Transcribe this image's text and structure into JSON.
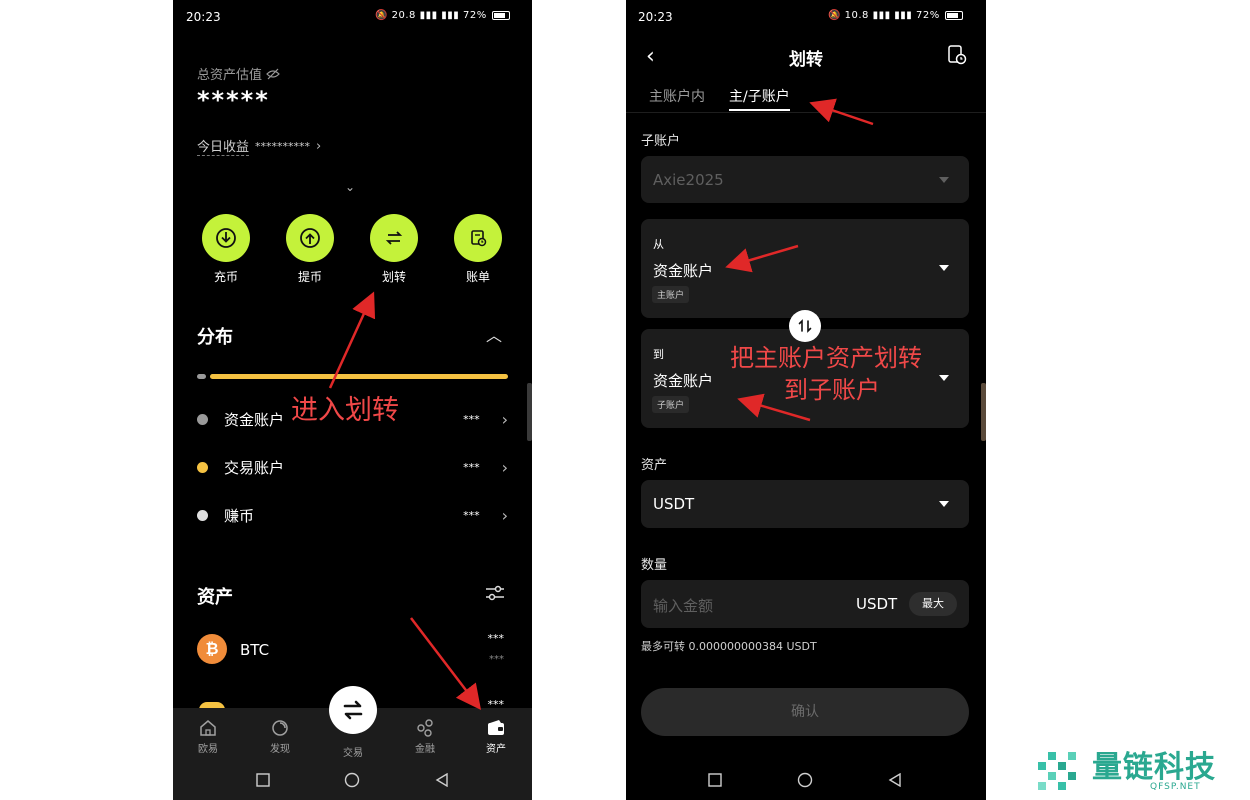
{
  "left": {
    "status": {
      "time": "20:23",
      "battery": "72%",
      "speed": "20.8"
    },
    "total_assets_label": "总资产估值",
    "total_assets_value": "*****",
    "today_pnl_label": "今日收益",
    "today_pnl_value": "**********",
    "actions": [
      {
        "label": "充币",
        "icon": "deposit-icon"
      },
      {
        "label": "提币",
        "icon": "withdraw-icon"
      },
      {
        "label": "划转",
        "icon": "transfer-icon"
      },
      {
        "label": "账单",
        "icon": "bill-icon"
      }
    ],
    "distribution_title": "分布",
    "distribution_rows": [
      {
        "label": "资金账户",
        "value": "***",
        "color": "#9a9a9a"
      },
      {
        "label": "交易账户",
        "value": "***",
        "color": "#f5c242"
      },
      {
        "label": "赚币",
        "value": "***",
        "color": "#e0e0e0"
      }
    ],
    "assets_title": "资产",
    "assets": [
      {
        "symbol": "BTC",
        "value": "***",
        "sub": "***"
      },
      {
        "symbol": "",
        "value": "***",
        "sub": ""
      }
    ],
    "nav": [
      {
        "label": "欧易",
        "icon": "home-icon"
      },
      {
        "label": "发现",
        "icon": "discover-icon"
      },
      {
        "label": "交易",
        "icon": "trade-icon"
      },
      {
        "label": "金融",
        "icon": "finance-icon"
      },
      {
        "label": "资产",
        "icon": "wallet-icon"
      }
    ],
    "annotation": "进入划转"
  },
  "right": {
    "status": {
      "time": "20:23",
      "battery": "72%",
      "speed": "10.8"
    },
    "title": "划转",
    "tabs": [
      "主账户内",
      "主/子账户"
    ],
    "active_tab": 1,
    "sub_account_label": "子账户",
    "sub_account_value": "Axie2025",
    "from_label": "从",
    "from_value": "资金账户",
    "from_tag": "主账户",
    "to_label": "到",
    "to_value": "资金账户",
    "to_tag": "子账户",
    "asset_label": "资产",
    "asset_value": "USDT",
    "amount_label": "数量",
    "amount_placeholder": "输入金额",
    "amount_unit": "USDT",
    "max_button": "最大",
    "max_transfer": "最多可转 0.000000000384 USDT",
    "confirm_button": "确认",
    "annotation_line1": "把主账户资产划转",
    "annotation_line2": "到子账户"
  },
  "watermark": {
    "text": "量链科技",
    "sub": "QFSP.NET"
  },
  "colors": {
    "accent": "#c4f23a",
    "annotation": "#f04848",
    "progress": "#f5c242"
  }
}
